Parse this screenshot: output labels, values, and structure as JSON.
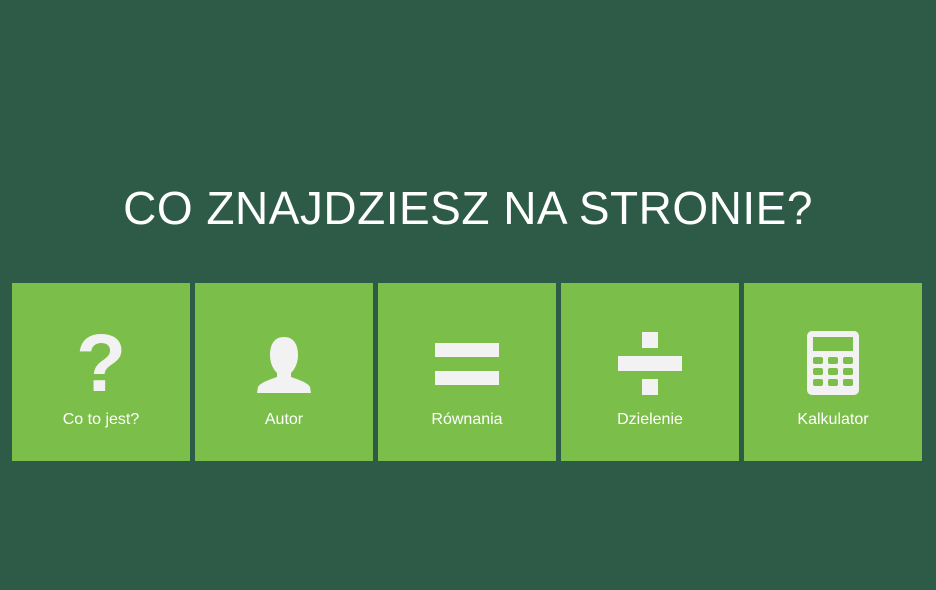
{
  "heading": "CO ZNAJDZIESZ NA STRONIE?",
  "colors": {
    "background": "#2e5a48",
    "tile": "#7bbf4a",
    "icon": "#f2f2f2",
    "text": "#ffffff"
  },
  "tiles": [
    {
      "label": "Co to jest?",
      "icon": "question-mark-icon"
    },
    {
      "label": "Autor",
      "icon": "user-icon"
    },
    {
      "label": "Równania",
      "icon": "equals-icon"
    },
    {
      "label": "Dzielenie",
      "icon": "divide-icon"
    },
    {
      "label": "Kalkulator",
      "icon": "calculator-icon"
    }
  ]
}
